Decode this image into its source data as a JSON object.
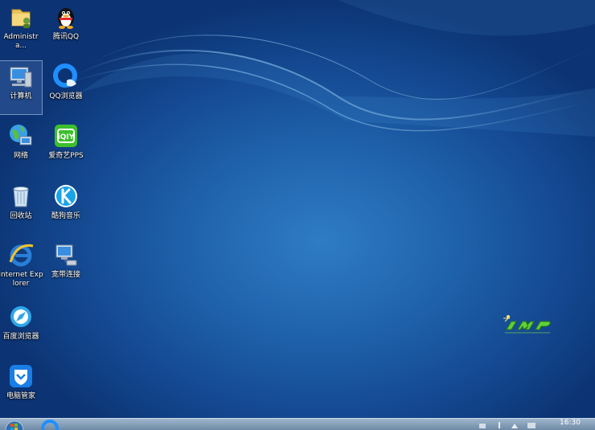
{
  "desktop": {
    "icons": [
      {
        "label": "Administra...",
        "icon": "user-folder-icon"
      },
      {
        "label": "腾讯QQ",
        "icon": "qq-penguin-icon"
      },
      {
        "label": "计算机",
        "icon": "computer-icon"
      },
      {
        "label": "QQ浏览器",
        "icon": "qq-browser-icon"
      },
      {
        "label": "网络",
        "icon": "network-icon"
      },
      {
        "label": "爱奇艺PPS",
        "icon": "iqiyi-icon"
      },
      {
        "label": "回收站",
        "icon": "recycle-bin-icon"
      },
      {
        "label": "酷狗音乐",
        "icon": "kugou-icon"
      },
      {
        "label": "Internet Explorer",
        "icon": "ie-icon"
      },
      {
        "label": "宽带连接",
        "icon": "broadband-icon"
      },
      {
        "label": "百度浏览器",
        "icon": "baidu-browser-icon"
      },
      {
        "label": "电脑管家",
        "icon": "pc-manager-icon"
      }
    ],
    "selected": "计算机"
  },
  "taskbar": {
    "clock_time": "16:30"
  },
  "colors": {
    "wallpaper_dark": "#0c3474",
    "wallpaper_light": "#2f7cc4",
    "taskbar": "#8aa3bd"
  }
}
